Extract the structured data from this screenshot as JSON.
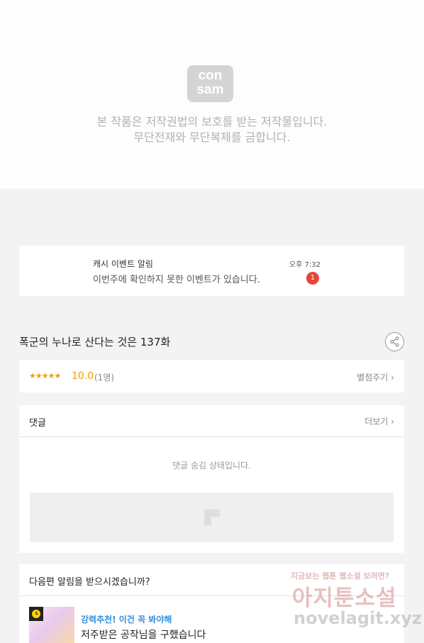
{
  "copyright": {
    "logo_line1": "con",
    "logo_line2": "sam",
    "notice_line1": "본 작품은 저작권법의 보호를 받는 저작물입니다.",
    "notice_line2": "무단전재와 무단복제를 금합니다."
  },
  "event_notification": {
    "title": "캐시 이벤트 알림",
    "message": "이번주에 확인하지 못한 이벤트가 있습니다.",
    "time": "오후 7:32",
    "badge_count": "1"
  },
  "episode": {
    "title": "폭군의 누나로 산다는 것은 137화",
    "share_icon": "share-icon"
  },
  "rating": {
    "stars": "★★★★★",
    "score": "10.0",
    "votes": "(1명)",
    "rate_button": "별점주기",
    "star_color": "#f0a100"
  },
  "comments": {
    "title": "댓글",
    "more_button": "더보기",
    "hidden_message": "댓글 숨김 상태입니다."
  },
  "subscribe": {
    "question": "다음편 알림을 받으시겠습니까?",
    "promo_tag": "강력추천! 이건 꼭 봐야해",
    "promo_title": "저주받은 공작님을 구했습니다",
    "tag_color": "#2f8fe0"
  },
  "watermark": {
    "top": "지금보는 웹툰 웹소설 보려면?",
    "main": "아지툰소설",
    "url": "novelagit.xyz"
  }
}
